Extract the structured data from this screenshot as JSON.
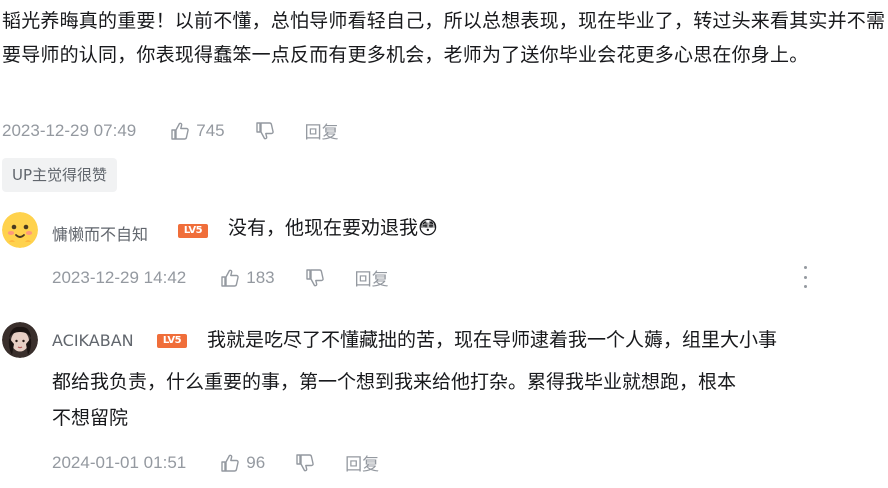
{
  "main_comment": {
    "text": "韬光养晦真的重要！以前不懂，总怕导师看轻自己，所以总想表现，现在毕业了，转过头来看其实并不需要导师的认同，你表现得蠢笨一点反而有更多机会，老师为了送你毕业会花更多心思在你身上。",
    "time": "2023-12-29 07:49",
    "likes": "745",
    "reply_label": "回复",
    "up_badge": "UP主觉得很赞"
  },
  "replies": [
    {
      "username": "慵懒而不自知",
      "level": "LV5",
      "text": "没有，他现在要劝退我",
      "emoji": "😳",
      "time": "2023-12-29 14:42",
      "likes": "183",
      "reply_label": "回复"
    },
    {
      "username": "ACIKABAN",
      "level": "LV5",
      "text_line1": "我就是吃尽了不懂藏拙的苦，现在导师逮着我一个人薅，组里大小事",
      "text_line2": "都给我负责，什么重要的事，第一个想到我来给他打杂。累得我毕业就想跑，根本",
      "text_line3": "不想留院",
      "time": "2024-01-01 01:51",
      "likes": "96",
      "reply_label": "回复"
    }
  ],
  "colors": {
    "text": "#18191c",
    "meta": "#9499a0",
    "username": "#61666d",
    "level_badge": "#f06e3a",
    "badge_bg": "#f1f2f3"
  }
}
